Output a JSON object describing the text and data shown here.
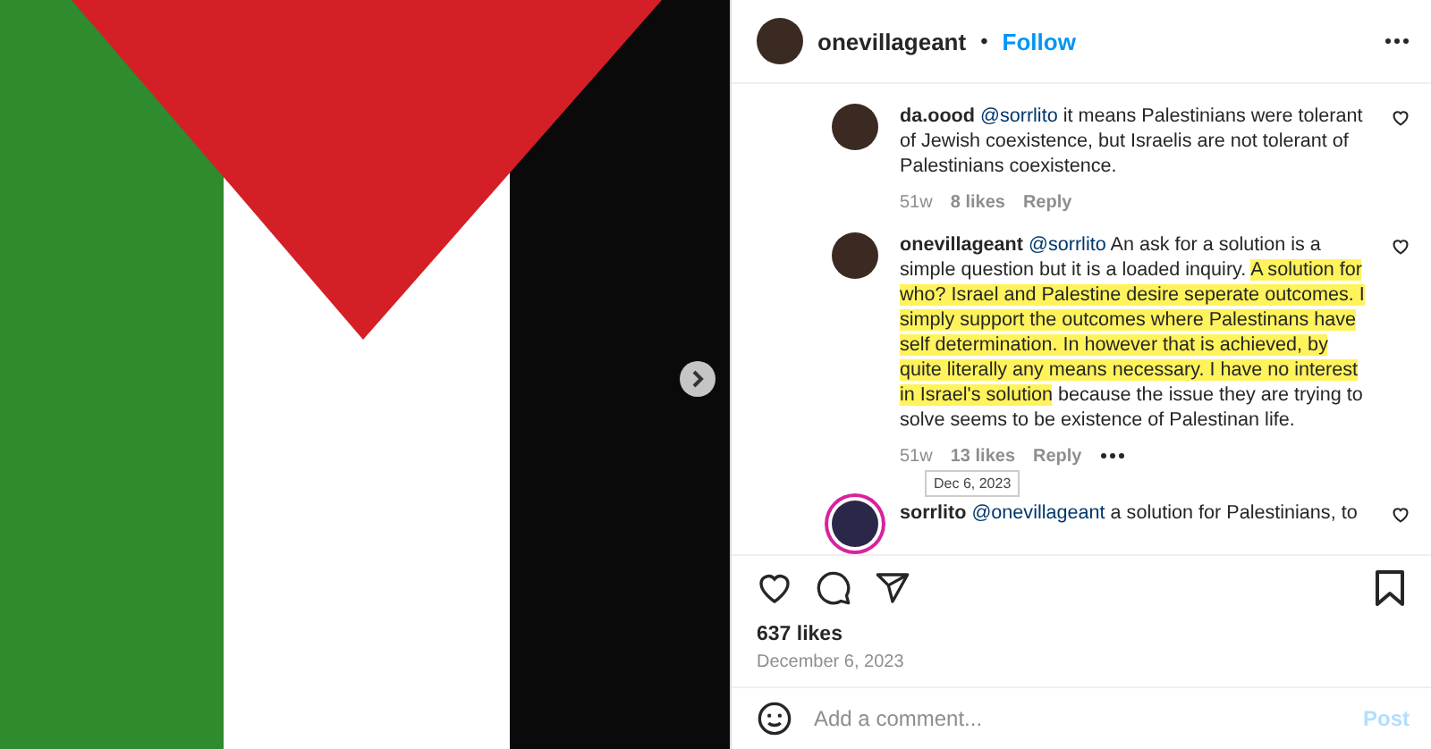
{
  "post": {
    "header": {
      "username": "onevillageant",
      "separator": "•",
      "follow": "Follow"
    },
    "comments": [
      {
        "username": "da.oood",
        "mention": "@sorrlito",
        "segments": [
          {
            "text": "it means Palestinians were tolerant of Jewish coexistence, but Israelis are not tolerant of Palestinians coexistence.",
            "highlighted": false
          }
        ],
        "time": "51w",
        "likes": "8 likes",
        "reply": "Reply",
        "story_ring": false
      },
      {
        "username": "onevillageant",
        "mention": "@sorrlito",
        "segments": [
          {
            "text": "An ask for a solution is a simple question but it is a loaded inquiry. ",
            "highlighted": false
          },
          {
            "text": "A solution for who? Israel and Palestine desire seperate outcomes.",
            "highlighted": true
          },
          {
            "text": " I simply support the outcomes where Palestinans have self determination. In however that is achieved, by quite literally any means necessary. I have no interest in Israel's solution",
            "highlighted": true
          },
          {
            "text": " because the issue they are trying to solve seems to be existence of Palestinan life.",
            "highlighted": false
          }
        ],
        "time": "51w",
        "likes": "13 likes",
        "reply": "Reply",
        "story_ring": false,
        "tooltip": "Dec 6, 2023"
      },
      {
        "username": "sorrlito",
        "mention": "@onevillageant",
        "segments": [
          {
            "text": "a solution for Palestinians, to",
            "highlighted": false
          }
        ],
        "story_ring": true
      }
    ],
    "likes": "637 likes",
    "date": "December 6, 2023",
    "comment_field": {
      "placeholder": "Add a comment..."
    },
    "post_button": {
      "label": "Post",
      "disabled": true
    }
  }
}
